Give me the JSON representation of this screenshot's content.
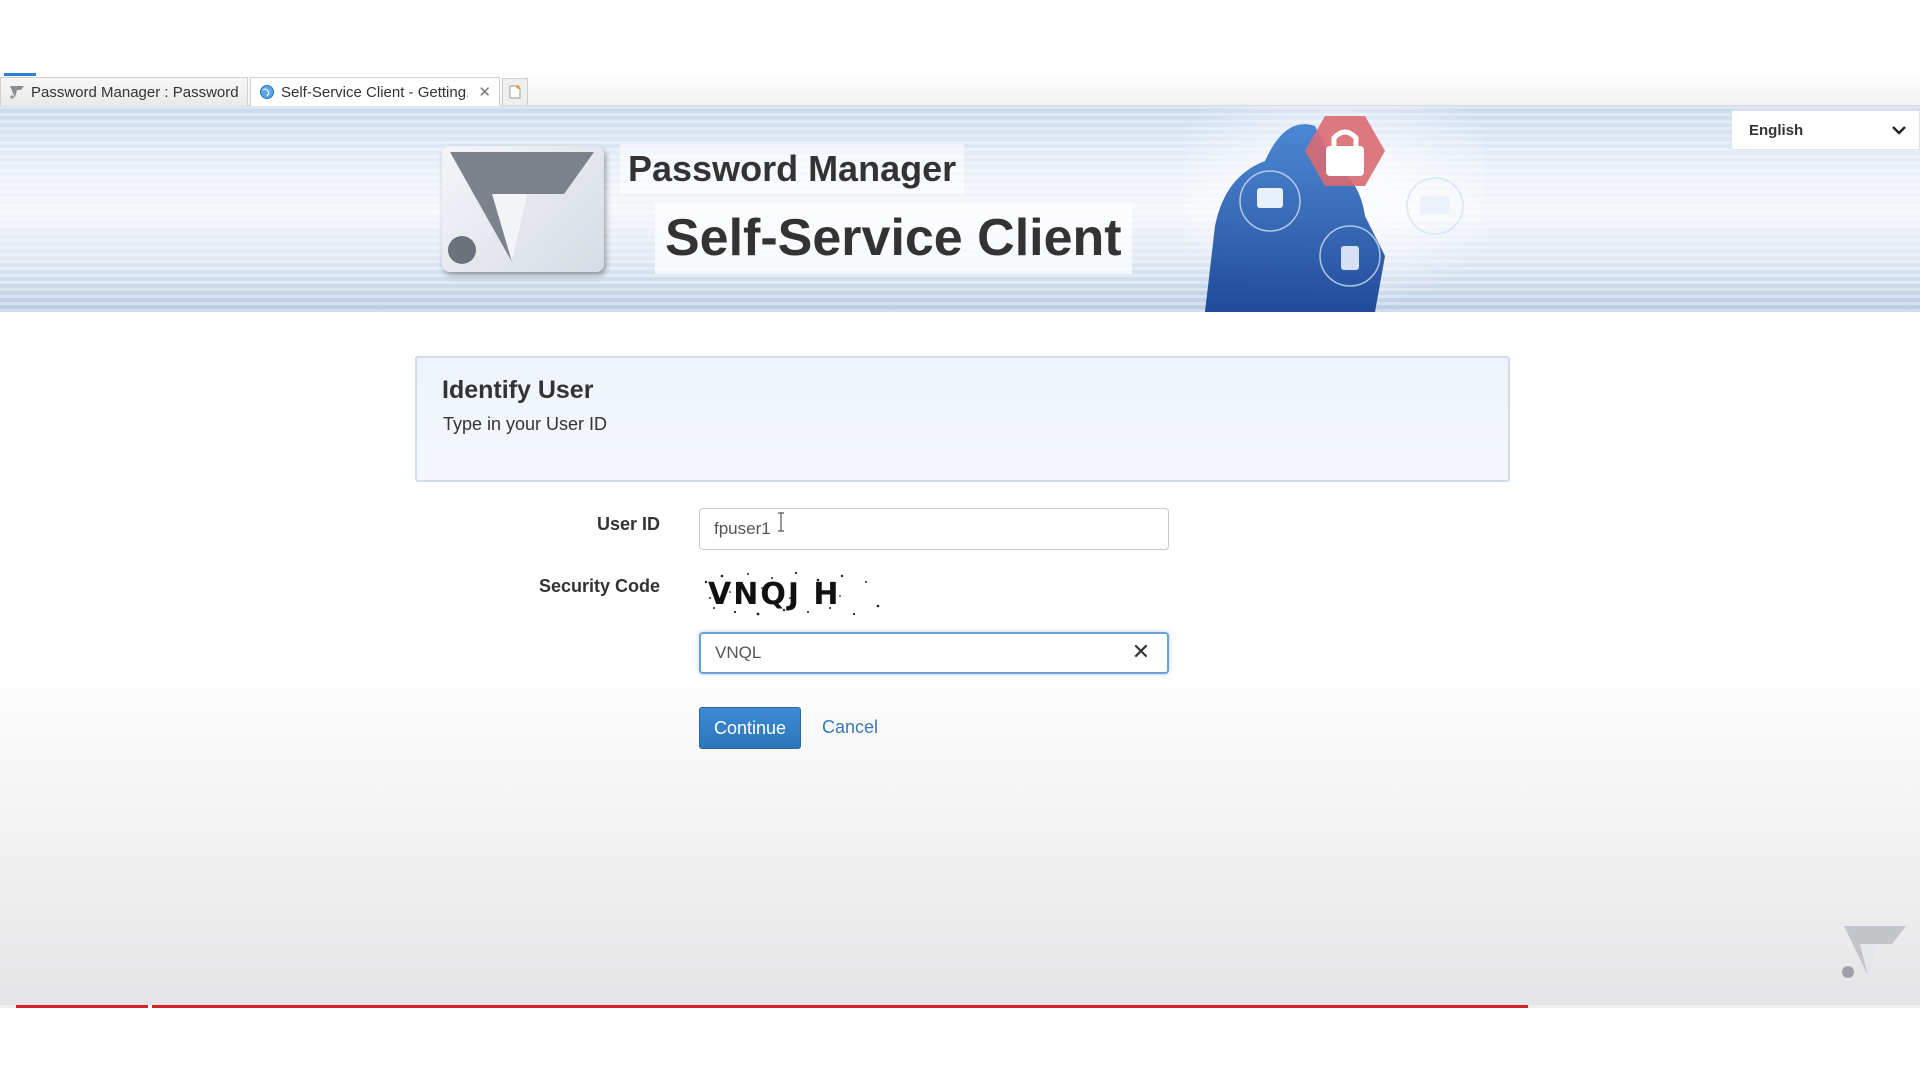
{
  "browser": {
    "tabs": [
      {
        "title": "Password Manager : Password ...",
        "active": false
      },
      {
        "title": "Self-Service Client - Getting...",
        "active": true
      }
    ]
  },
  "banner": {
    "title": "Password Manager",
    "subtitle": "Self-Service Client",
    "language": {
      "selected": "English"
    }
  },
  "panel": {
    "heading": "Identify User",
    "instruction": "Type in your User ID"
  },
  "form": {
    "user_id_label": "User ID",
    "user_id_value": "fpuser1",
    "security_code_label": "Security Code",
    "captcha_text": "VNQJ H",
    "security_code_value": "VNQL",
    "continue_label": "Continue",
    "cancel_label": "Cancel"
  },
  "colors": {
    "primary_button": "#337ab7",
    "link": "#3a78b6",
    "progress_red": "#d6202a"
  }
}
